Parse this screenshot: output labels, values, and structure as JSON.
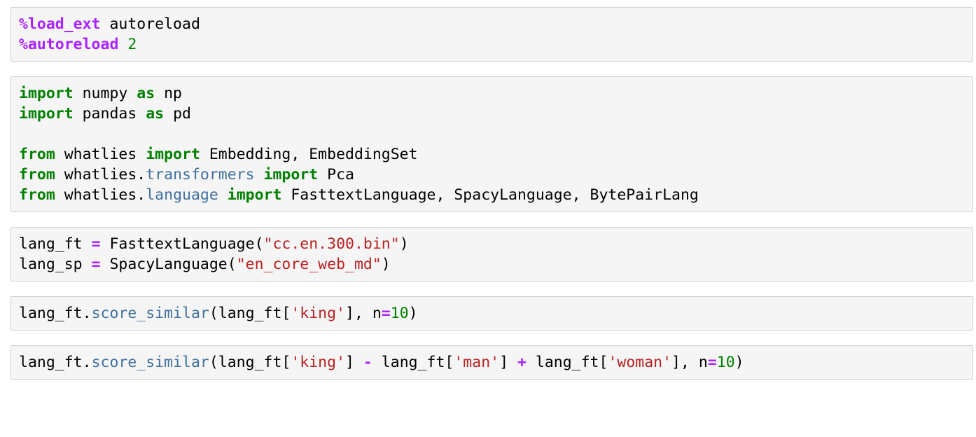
{
  "notebook": {
    "background_color": "#ffffff",
    "cell_background_color": "#f5f5f5",
    "cell_border_color": "#cfcfcf",
    "syntax_colors": {
      "keyword": "#008000",
      "magic": "#AA22FF",
      "operator": "#AA22FF",
      "number": "#008000",
      "string": "#BA2121",
      "module": "#4070A0",
      "function": "#4070A0",
      "plain": "#000000"
    },
    "cells": [
      {
        "index": 0,
        "name": "autoreload-magic-cell",
        "lines": [
          {
            "tokens": [
              {
                "t": "%load_ext",
                "c": "magic"
              },
              {
                "t": " autoreload",
                "c": "plain"
              }
            ]
          },
          {
            "tokens": [
              {
                "t": "%autoreload",
                "c": "magic"
              },
              {
                "t": " ",
                "c": "plain"
              },
              {
                "t": "2",
                "c": "number"
              }
            ]
          }
        ]
      },
      {
        "index": 1,
        "name": "imports-cell",
        "lines": [
          {
            "tokens": [
              {
                "t": "import",
                "c": "keyword"
              },
              {
                "t": " numpy ",
                "c": "plain"
              },
              {
                "t": "as",
                "c": "keyword"
              },
              {
                "t": " np",
                "c": "plain"
              }
            ]
          },
          {
            "tokens": [
              {
                "t": "import",
                "c": "keyword"
              },
              {
                "t": " pandas ",
                "c": "plain"
              },
              {
                "t": "as",
                "c": "keyword"
              },
              {
                "t": " pd",
                "c": "plain"
              }
            ]
          },
          {
            "tokens": []
          },
          {
            "tokens": [
              {
                "t": "from",
                "c": "keyword"
              },
              {
                "t": " whatlies ",
                "c": "plain"
              },
              {
                "t": "import",
                "c": "keyword"
              },
              {
                "t": " Embedding, EmbeddingSet",
                "c": "plain"
              }
            ]
          },
          {
            "tokens": [
              {
                "t": "from",
                "c": "keyword"
              },
              {
                "t": " whatlies.",
                "c": "plain"
              },
              {
                "t": "transformers",
                "c": "module"
              },
              {
                "t": " ",
                "c": "plain"
              },
              {
                "t": "import",
                "c": "keyword"
              },
              {
                "t": " Pca",
                "c": "plain"
              }
            ]
          },
          {
            "tokens": [
              {
                "t": "from",
                "c": "keyword"
              },
              {
                "t": " whatlies.",
                "c": "plain"
              },
              {
                "t": "language",
                "c": "module"
              },
              {
                "t": " ",
                "c": "plain"
              },
              {
                "t": "import",
                "c": "keyword"
              },
              {
                "t": " FasttextLanguage, SpacyLanguage, BytePairLang",
                "c": "plain"
              }
            ]
          }
        ]
      },
      {
        "index": 2,
        "name": "language-instantiation-cell",
        "lines": [
          {
            "tokens": [
              {
                "t": "lang_ft ",
                "c": "plain"
              },
              {
                "t": "=",
                "c": "operator"
              },
              {
                "t": " FasttextLanguage(",
                "c": "plain"
              },
              {
                "t": "\"cc.en.300.bin\"",
                "c": "string"
              },
              {
                "t": ")",
                "c": "plain"
              }
            ]
          },
          {
            "tokens": [
              {
                "t": "lang_sp ",
                "c": "plain"
              },
              {
                "t": "=",
                "c": "operator"
              },
              {
                "t": " SpacyLanguage(",
                "c": "plain"
              },
              {
                "t": "\"en_core_web_md\"",
                "c": "string"
              },
              {
                "t": ")",
                "c": "plain"
              }
            ]
          }
        ]
      },
      {
        "index": 3,
        "name": "score-similar-king-cell",
        "lines": [
          {
            "tokens": [
              {
                "t": "lang_ft.",
                "c": "plain"
              },
              {
                "t": "score_similar",
                "c": "function"
              },
              {
                "t": "(lang_ft[",
                "c": "plain"
              },
              {
                "t": "'king'",
                "c": "string"
              },
              {
                "t": "], n",
                "c": "plain"
              },
              {
                "t": "=",
                "c": "operator"
              },
              {
                "t": "10",
                "c": "number"
              },
              {
                "t": ")",
                "c": "plain"
              }
            ]
          }
        ]
      },
      {
        "index": 4,
        "name": "score-similar-analogy-cell",
        "lines": [
          {
            "tokens": [
              {
                "t": "lang_ft.",
                "c": "plain"
              },
              {
                "t": "score_similar",
                "c": "function"
              },
              {
                "t": "(lang_ft[",
                "c": "plain"
              },
              {
                "t": "'king'",
                "c": "string"
              },
              {
                "t": "] ",
                "c": "plain"
              },
              {
                "t": "-",
                "c": "operator"
              },
              {
                "t": " lang_ft[",
                "c": "plain"
              },
              {
                "t": "'man'",
                "c": "string"
              },
              {
                "t": "] ",
                "c": "plain"
              },
              {
                "t": "+",
                "c": "operator"
              },
              {
                "t": " lang_ft[",
                "c": "plain"
              },
              {
                "t": "'woman'",
                "c": "string"
              },
              {
                "t": "], n",
                "c": "plain"
              },
              {
                "t": "=",
                "c": "operator"
              },
              {
                "t": "10",
                "c": "number"
              },
              {
                "t": ")",
                "c": "plain"
              }
            ]
          }
        ]
      }
    ]
  }
}
